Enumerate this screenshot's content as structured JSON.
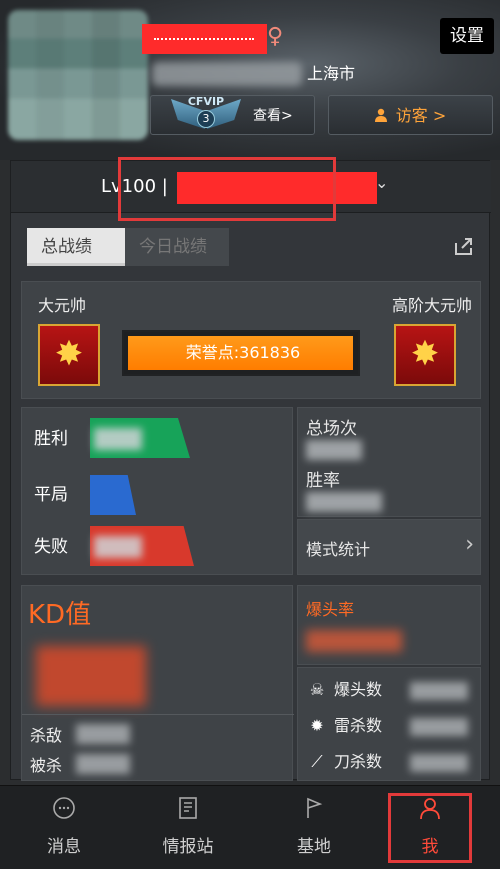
{
  "header": {
    "settings_label": "设置",
    "city": "上海市",
    "vip": {
      "badge_text": "CFVIP",
      "level": "3",
      "view_label": "查看>"
    },
    "visitor_label": "访客 >"
  },
  "level": {
    "text": "Lv100 |"
  },
  "tabs": [
    {
      "label": "总战绩",
      "active": true
    },
    {
      "label": "今日战绩",
      "active": false
    }
  ],
  "rank": {
    "current": "大元帅",
    "next": "高阶大元帅",
    "honor_label": "荣誉点:361836",
    "progress": 0.98
  },
  "stats": {
    "win_label": "胜利",
    "draw_label": "平局",
    "lose_label": "失败",
    "total_games_label": "总场次",
    "win_rate_label": "胜率",
    "mode_stats_label": "模式统计"
  },
  "kd": {
    "title": "KD值",
    "kills_label": "杀敌",
    "deaths_label": "被杀"
  },
  "headshot": {
    "title": "爆头率"
  },
  "kills": {
    "headshots_label": "爆头数",
    "grenade_label": "雷杀数",
    "knife_label": "刀杀数"
  },
  "nav": [
    {
      "label": "消息",
      "icon": "message-icon"
    },
    {
      "label": "情报站",
      "icon": "intel-icon"
    },
    {
      "label": "基地",
      "icon": "base-icon"
    },
    {
      "label": "我",
      "icon": "profile-icon",
      "active": true
    }
  ],
  "colors": {
    "accent_orange": "#ff7d00",
    "highlight_red": "#e23a3a",
    "win_green": "#17a359",
    "draw_blue": "#2a6ad0",
    "lose_red": "#d8392c"
  }
}
